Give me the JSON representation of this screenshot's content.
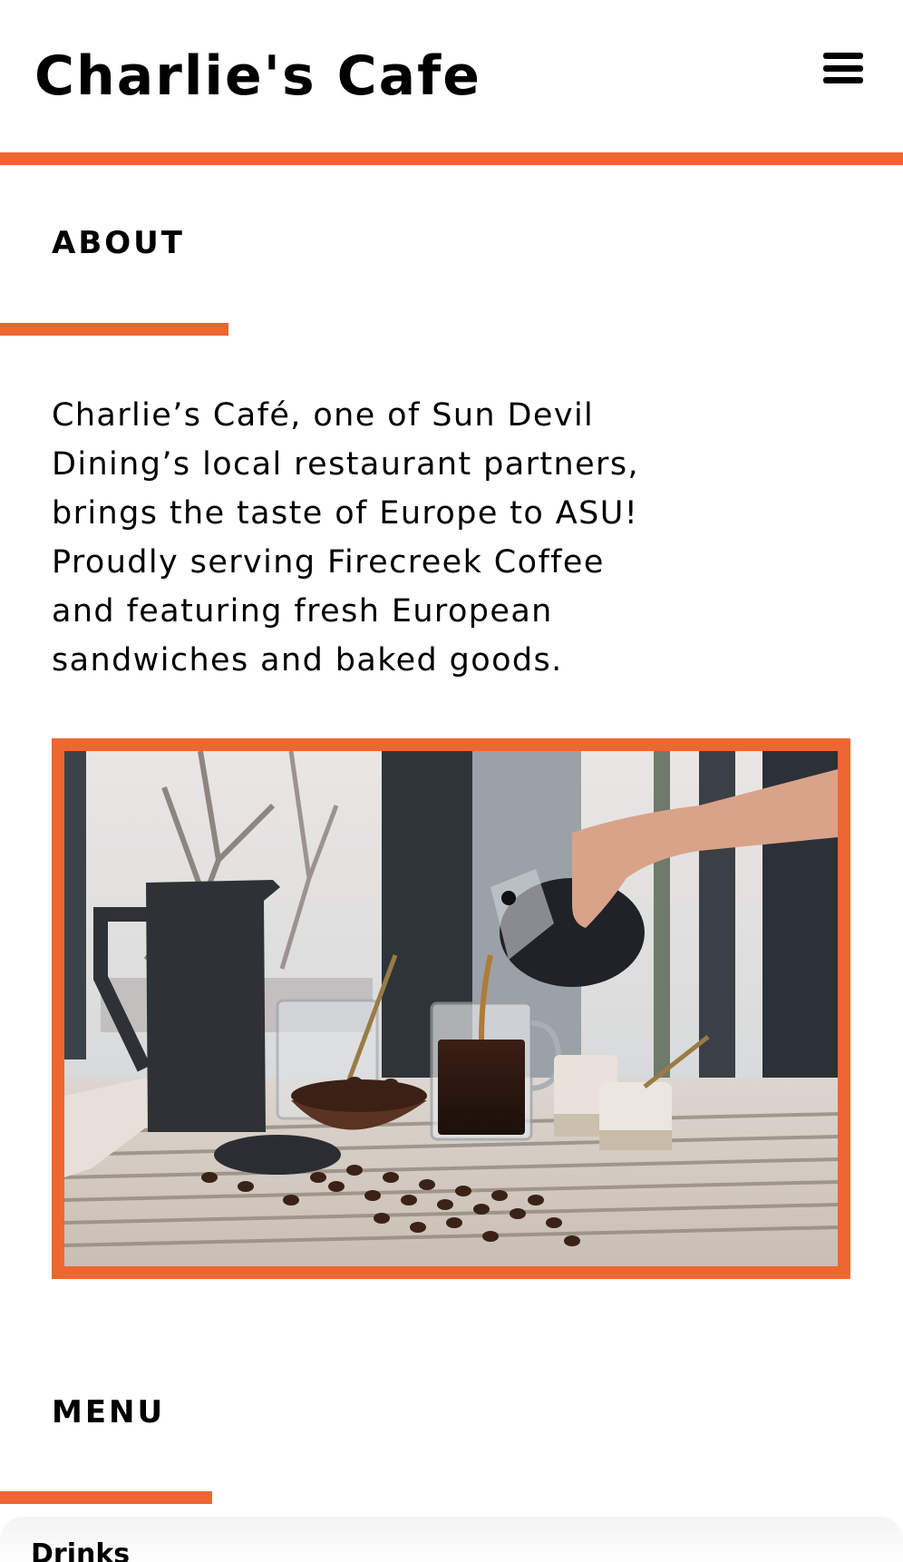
{
  "header": {
    "brand": "Charlie's Cafe",
    "menu_icon": "hamburger-menu-icon"
  },
  "about": {
    "title": "ABOUT",
    "lines": [
      "Charlie’s Café, one of Sun Devil",
      "Dining’s local restaurant partners,",
      "brings the taste of Europe to ASU!",
      "Proudly serving Firecreek Coffee",
      "and featuring fresh European",
      "sandwiches and baked goods."
    ]
  },
  "menu": {
    "title": "MENU",
    "first_category": "Drinks"
  },
  "colors": {
    "accent": "#ee6630",
    "text": "#000000",
    "background": "#ffffff"
  }
}
